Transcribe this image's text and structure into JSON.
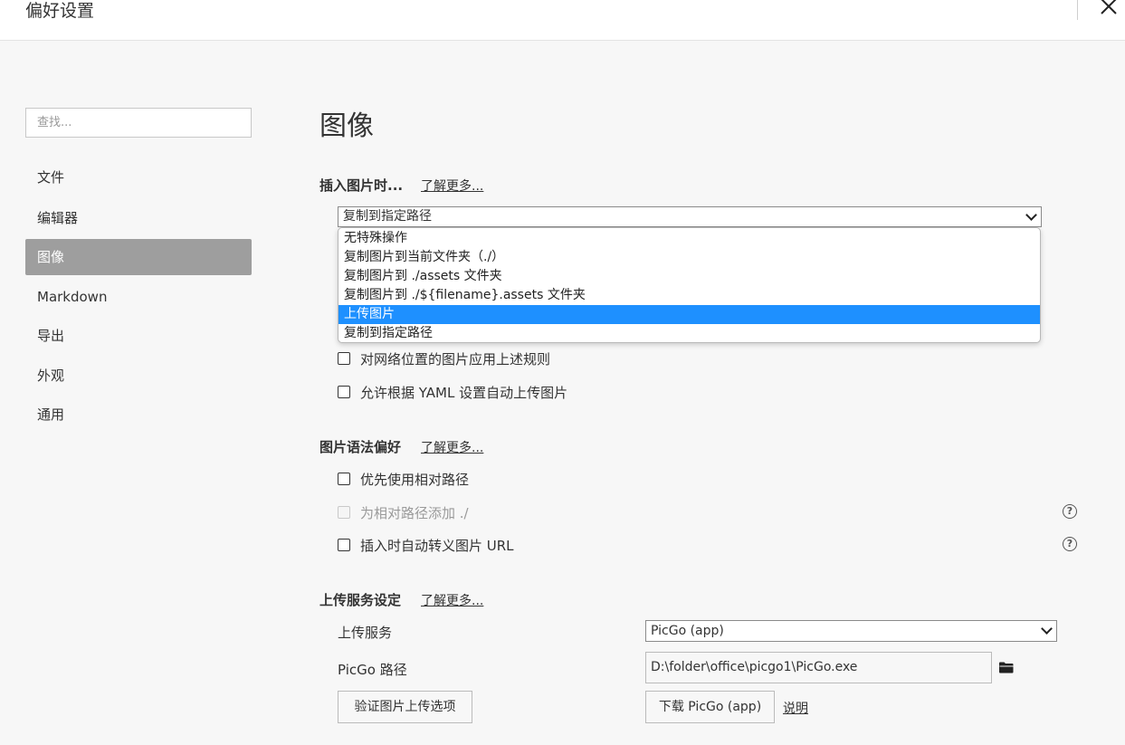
{
  "window": {
    "title": "偏好设置"
  },
  "search": {
    "placeholder": "查找..."
  },
  "sidebar": {
    "items": [
      {
        "label": "文件"
      },
      {
        "label": "编辑器"
      },
      {
        "label": "图像"
      },
      {
        "label": "Markdown"
      },
      {
        "label": "导出"
      },
      {
        "label": "外观"
      },
      {
        "label": "通用"
      }
    ]
  },
  "main": {
    "title": "图像",
    "insert_section": {
      "heading": "插入图片时...",
      "learn_more": "了解更多...",
      "selected": "复制到指定路径",
      "options": [
        "无特殊操作",
        "复制图片到当前文件夹（./）",
        "复制图片到 ./assets 文件夹",
        "复制图片到 ./${filename}.assets 文件夹",
        "上传图片",
        "复制到指定路径"
      ],
      "checkboxes": [
        {
          "label": "对网络位置的图片应用上述规则",
          "checked": false
        },
        {
          "label": "允许根据 YAML 设置自动上传图片",
          "checked": false
        }
      ]
    },
    "syntax_section": {
      "heading": "图片语法偏好",
      "learn_more": "了解更多...",
      "checkboxes": [
        {
          "label": "优先使用相对路径",
          "checked": false
        },
        {
          "label": "为相对路径添加 ./",
          "checked": false,
          "disabled": true
        },
        {
          "label": "插入时自动转义图片 URL",
          "checked": false
        }
      ],
      "help_glyph": "?"
    },
    "upload_section": {
      "heading": "上传服务设定",
      "learn_more": "了解更多...",
      "service_label": "上传服务",
      "service_value": "PicGo (app)",
      "path_label": "PicGo 路径",
      "path_value": "D:\\folder\\office\\picgo1\\PicGo.exe",
      "verify_button": "验证图片上传选项",
      "download_button": "下载 PicGo (app)",
      "help_link": "说明"
    }
  },
  "colors": {
    "accent_selected": "#1e90ff",
    "sidebar_active": "#9e9e9e"
  }
}
